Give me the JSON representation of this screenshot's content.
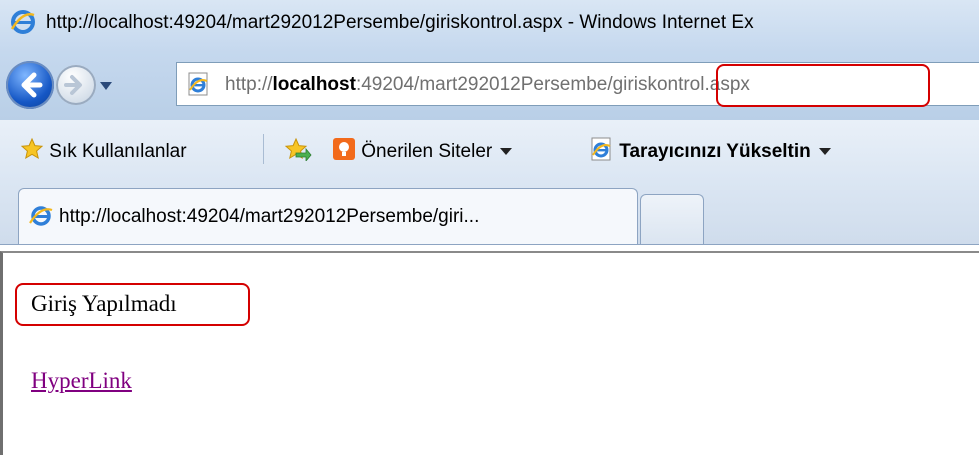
{
  "window": {
    "title": "http://localhost:49204/mart292012Persembe/giriskontrol.aspx - Windows Internet Ex"
  },
  "address_bar": {
    "url_prefix": "http://",
    "url_host": "localhost",
    "url_path": ":49204/mart292012Persembe/",
    "url_page": "giriskontrol.aspx"
  },
  "favorites_bar": {
    "favorites_label": "Sık Kullanılanlar",
    "suggested_sites_label": "Önerilen Siteler",
    "upgrade_label": "Tarayıcınızı Yükseltin"
  },
  "tabs": [
    {
      "label": "http://localhost:49204/mart292012Persembe/giri..."
    }
  ],
  "page": {
    "status_text": "Giriş Yapılmadı",
    "link_text": "HyperLink"
  },
  "colors": {
    "highlight": "#d40000",
    "visited_link": "#800080"
  },
  "icons": [
    "ie-logo-icon",
    "back-icon",
    "forward-icon",
    "star-icon",
    "add-favorite-icon",
    "suggested-sites-icon",
    "ie-page-icon"
  ]
}
